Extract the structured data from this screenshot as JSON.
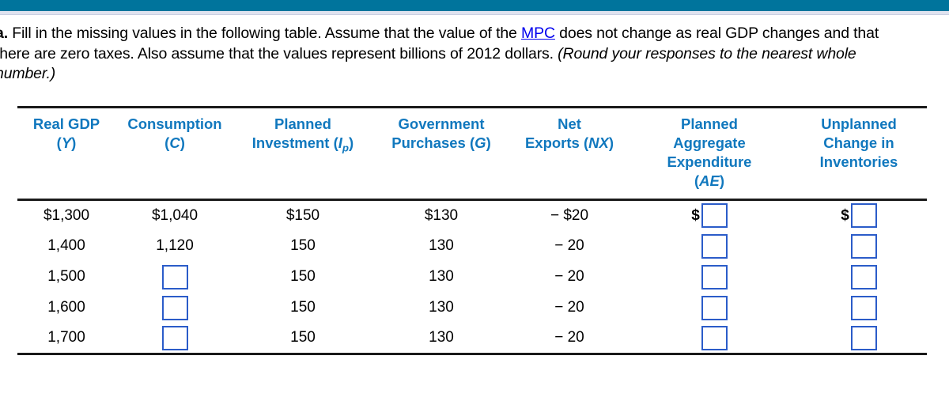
{
  "theme": {
    "accent_bar": "#00749c",
    "header_text": "#1178be",
    "link": "#0000ee",
    "input_border": "#2b5cc9"
  },
  "prompt": {
    "label": "a.",
    "text_part1": " Fill in the missing values in the following table. Assume that the value of the ",
    "link": "MPC",
    "text_part2": " does not change as real GDP changes and that there are zero taxes. Also assume that the values represent billions of 2012 dollars. ",
    "italic_note": "(Round your responses to the nearest whole number.)"
  },
  "table": {
    "headers": [
      {
        "line1": "Real GDP",
        "var": "Y"
      },
      {
        "line1": "Consumption",
        "var": "C"
      },
      {
        "line1": "Planned",
        "line2": "Investment",
        "var": "I",
        "sub": "p"
      },
      {
        "line1": "Government",
        "line2": "Purchases",
        "var": "G"
      },
      {
        "line1": "Net",
        "line2": "Exports",
        "var": "NX"
      },
      {
        "line1": "Planned",
        "line2": "Aggregate",
        "line3": "Expenditure",
        "var": "AE"
      },
      {
        "line1": "Unplanned",
        "line2": "Change in",
        "line3": "Inventories"
      }
    ],
    "rows": [
      {
        "real_gdp": "$1,300",
        "consumption": "$1,040",
        "planned_investment": "$150",
        "government_purchases": "$130",
        "net_exports": "− $20",
        "ae_prefix": "$",
        "ae_value": "",
        "unplanned_prefix": "$",
        "unplanned_value": ""
      },
      {
        "real_gdp": "1,400",
        "consumption": "1,120",
        "planned_investment": "150",
        "government_purchases": "130",
        "net_exports": "− 20",
        "ae_prefix": "",
        "ae_value": "",
        "unplanned_prefix": "",
        "unplanned_value": ""
      },
      {
        "real_gdp": "1,500",
        "consumption": "",
        "planned_investment": "150",
        "government_purchases": "130",
        "net_exports": "− 20",
        "ae_prefix": "",
        "ae_value": "",
        "unplanned_prefix": "",
        "unplanned_value": ""
      },
      {
        "real_gdp": "1,600",
        "consumption": "",
        "planned_investment": "150",
        "government_purchases": "130",
        "net_exports": "− 20",
        "ae_prefix": "",
        "ae_value": "",
        "unplanned_prefix": "",
        "unplanned_value": ""
      },
      {
        "real_gdp": "1,700",
        "consumption": "",
        "planned_investment": "150",
        "government_purchases": "130",
        "net_exports": "− 20",
        "ae_prefix": "",
        "ae_value": "",
        "unplanned_prefix": "",
        "unplanned_value": ""
      }
    ]
  }
}
